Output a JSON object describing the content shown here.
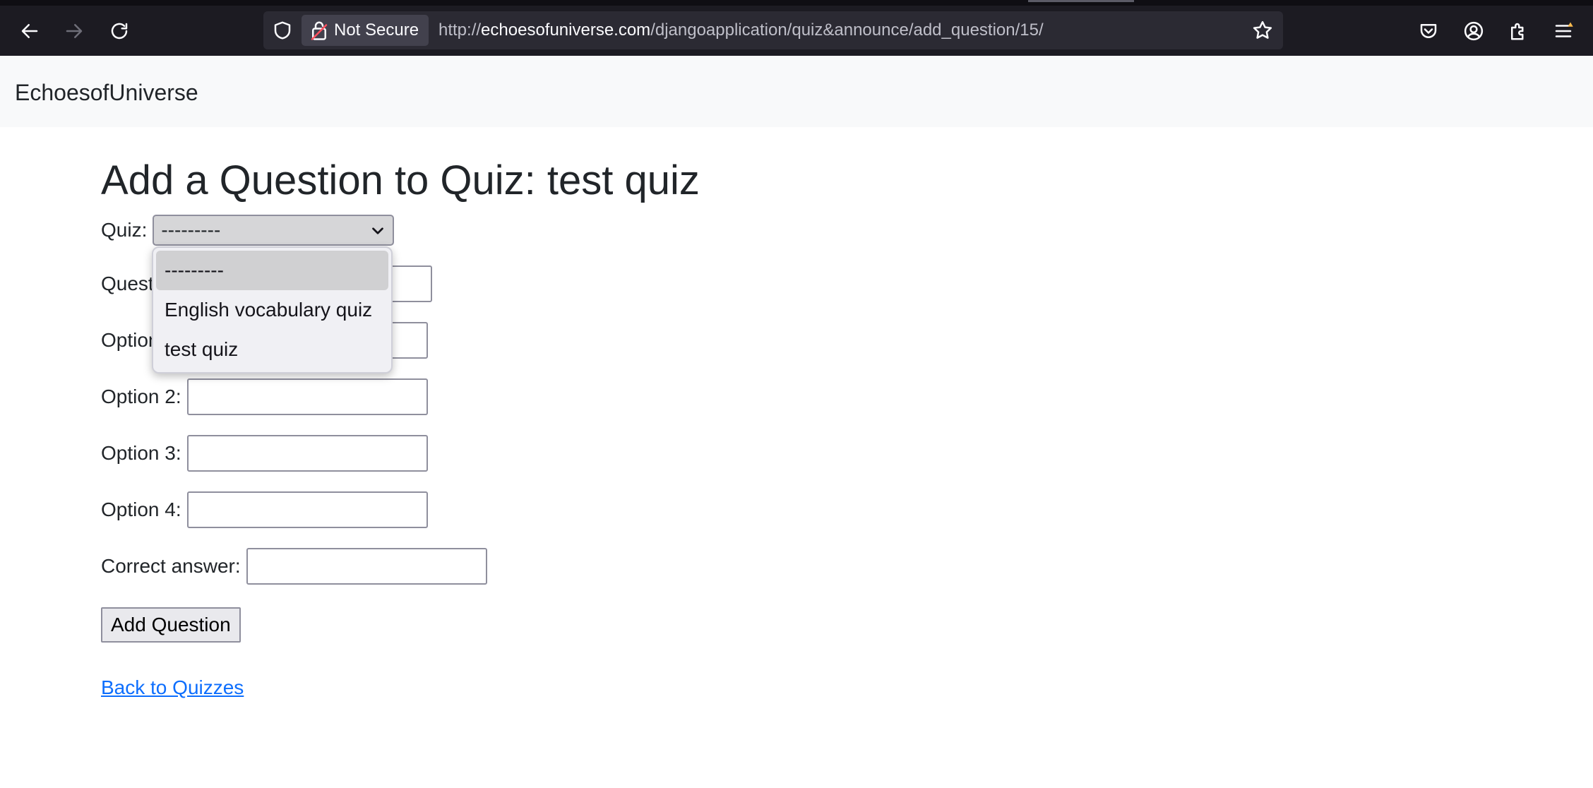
{
  "browser": {
    "security_label": "Not Secure",
    "url_prefix": "http://",
    "url_host": "echoesofuniverse.com",
    "url_path": "/djangoapplication/quiz&announce/add_question/15/"
  },
  "navbar": {
    "brand": "EchoesofUniverse"
  },
  "page": {
    "title": "Add a Question to Quiz: test quiz",
    "form": {
      "quiz_label": "Quiz:",
      "quiz_selected": "---------",
      "quiz_options": [
        "---------",
        "English vocabulary quiz",
        "test quiz"
      ],
      "question_label": "Question:",
      "option1_label": "Option 1:",
      "option2_label": "Option 2:",
      "option3_label": "Option 3:",
      "option4_label": "Option 4:",
      "correct_label": "Correct answer:",
      "submit_label": "Add Question"
    },
    "back_link": "Back to Quizzes"
  }
}
